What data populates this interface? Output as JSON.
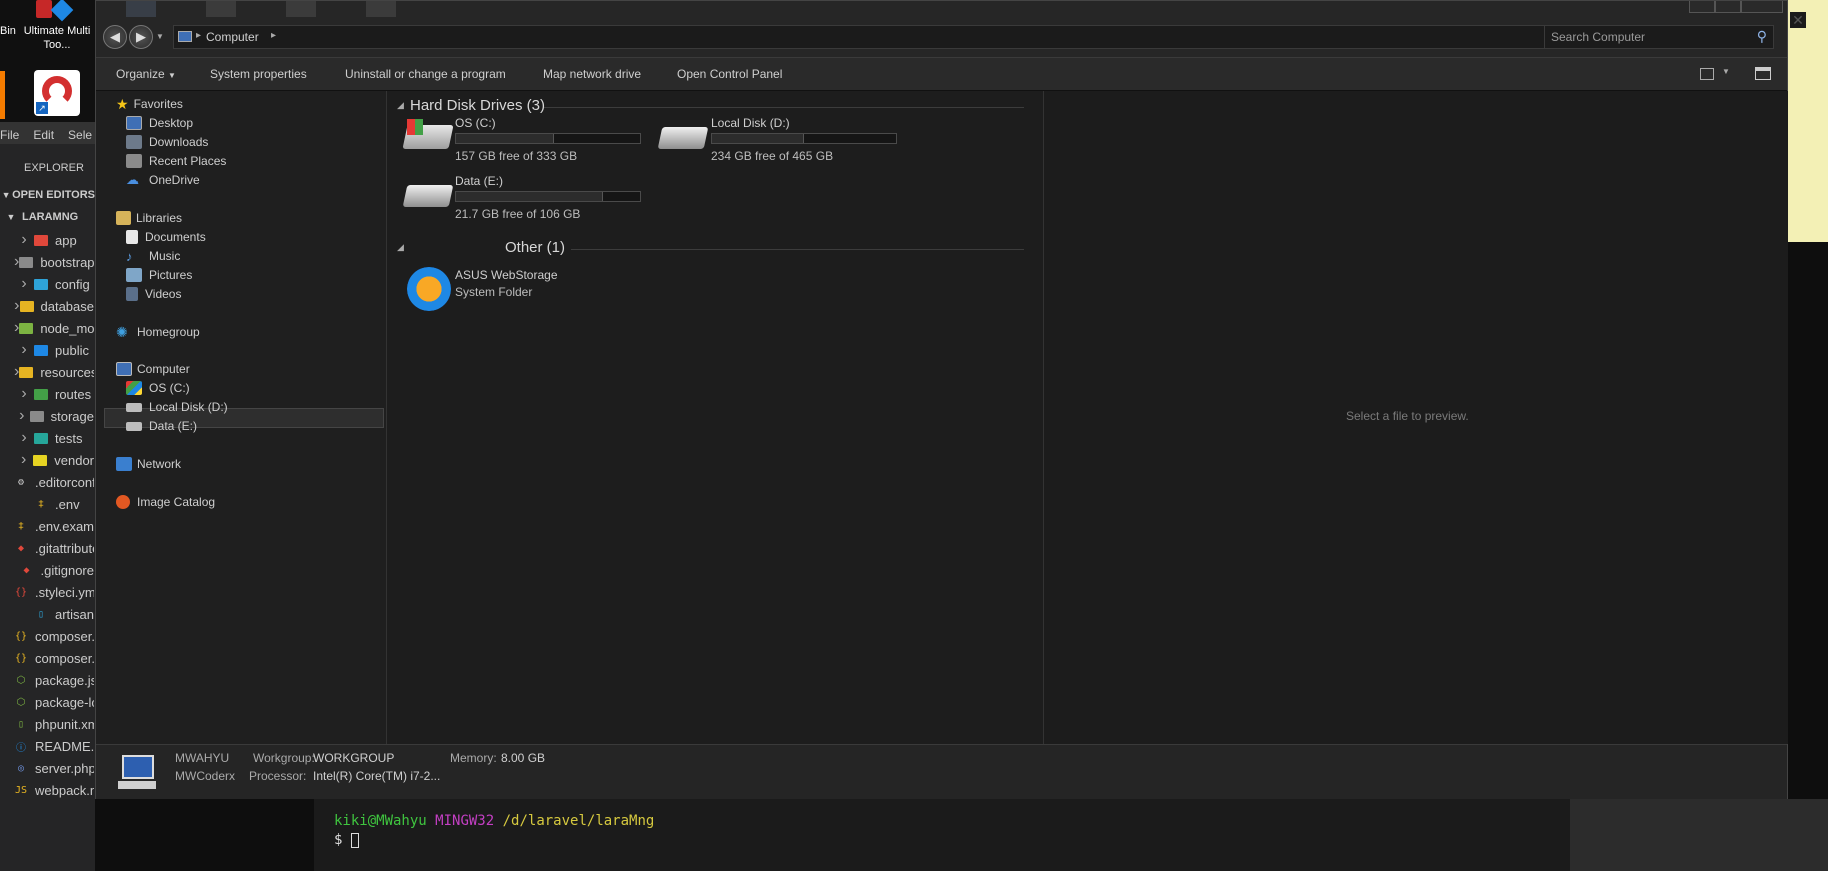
{
  "desktop": {
    "partial_label": "Bin",
    "ultimate_label": "Ultimate Multi Too..."
  },
  "vscode": {
    "menu": [
      "File",
      "Edit",
      "Sele"
    ],
    "explorer_title": "EXPLORER",
    "open_editors": "OPEN EDITORS",
    "project": "LARAMNG",
    "tree": [
      {
        "label": "app",
        "kind": "folder",
        "color": "#e0483b"
      },
      {
        "label": "bootstrap",
        "kind": "folder",
        "color": "#8a8a8a"
      },
      {
        "label": "config",
        "kind": "folder",
        "color": "#2ea3d8"
      },
      {
        "label": "database",
        "kind": "folder",
        "color": "#e6b422"
      },
      {
        "label": "node_modules",
        "kind": "folder",
        "color": "#7cb342"
      },
      {
        "label": "public",
        "kind": "folder",
        "color": "#1e88e5"
      },
      {
        "label": "resources",
        "kind": "folder",
        "color": "#e6b422"
      },
      {
        "label": "routes",
        "kind": "folder",
        "color": "#43a047"
      },
      {
        "label": "storage",
        "kind": "folder",
        "color": "#8a8a8a"
      },
      {
        "label": "tests",
        "kind": "folder",
        "color": "#26a69a"
      },
      {
        "label": "vendor",
        "kind": "folder",
        "color": "#e6d322"
      },
      {
        "label": ".editorconfig",
        "kind": "file",
        "glyph": "⚙",
        "color": "#cccccc"
      },
      {
        "label": ".env",
        "kind": "file",
        "glyph": "‡",
        "color": "#e6b422"
      },
      {
        "label": ".env.example",
        "kind": "file",
        "glyph": "‡",
        "color": "#e6b422"
      },
      {
        "label": ".gitattributes",
        "kind": "file",
        "glyph": "◆",
        "color": "#e0483b"
      },
      {
        "label": ".gitignore",
        "kind": "file",
        "glyph": "◆",
        "color": "#e0483b"
      },
      {
        "label": ".styleci.yml",
        "kind": "file",
        "glyph": "{}",
        "color": "#e0483b"
      },
      {
        "label": "artisan",
        "kind": "file",
        "glyph": "▯",
        "color": "#2ea3d8"
      },
      {
        "label": "composer.json",
        "kind": "file",
        "glyph": "{}",
        "color": "#e6b422"
      },
      {
        "label": "composer.lock",
        "kind": "file",
        "glyph": "{}",
        "color": "#e6b422"
      },
      {
        "label": "package.json",
        "kind": "file",
        "glyph": "⬡",
        "color": "#7cb342"
      },
      {
        "label": "package-lock.json",
        "kind": "file",
        "glyph": "⬡",
        "color": "#7cb342"
      },
      {
        "label": "phpunit.xml",
        "kind": "file",
        "glyph": "▯",
        "color": "#7cb342"
      },
      {
        "label": "README.md",
        "kind": "file",
        "glyph": "ⓘ",
        "color": "#2196f3"
      },
      {
        "label": "server.php",
        "kind": "file",
        "glyph": "◎",
        "color": "#6d8fd8"
      },
      {
        "label": "webpack.mix.js",
        "kind": "file",
        "glyph": "JS",
        "color": "#e6b422"
      }
    ]
  },
  "explorer": {
    "breadcrumb": "Computer",
    "search_placeholder": "Search Computer",
    "toolbar": {
      "organize": "Organize",
      "system_properties": "System properties",
      "uninstall": "Uninstall or change a program",
      "map_drive": "Map network drive",
      "control_panel": "Open Control Panel"
    },
    "nav": {
      "favorites": "Favorites",
      "favorites_items": [
        "Desktop",
        "Downloads",
        "Recent Places",
        "OneDrive"
      ],
      "libraries": "Libraries",
      "libraries_items": [
        "Documents",
        "Music",
        "Pictures",
        "Videos"
      ],
      "homegroup": "Homegroup",
      "computer": "Computer",
      "computer_items": [
        "OS (C:)",
        "Local Disk (D:)",
        "Data (E:)"
      ],
      "network": "Network",
      "image_catalog": "Image Catalog"
    },
    "groups": {
      "hdd_title": "Hard Disk Drives (3)",
      "other_title": "Other (1)"
    },
    "drives": [
      {
        "name": "OS (C:)",
        "free": "157 GB free of 333 GB",
        "used_fraction": 0.53
      },
      {
        "name": "Local Disk (D:)",
        "free": "234 GB free of 465 GB",
        "used_fraction": 0.5
      },
      {
        "name": "Data (E:)",
        "free": "21.7 GB free of 106 GB",
        "used_fraction": 0.8
      }
    ],
    "other": {
      "name": "ASUS WebStorage",
      "type": "System Folder"
    },
    "preview_text": "Select a file to preview.",
    "details": {
      "computer_name": "MWAHYU",
      "user": "MWCoderx",
      "workgroup_label": "Workgroup:",
      "workgroup_value": "WORKGROUP",
      "memory_label": "Memory:",
      "memory_value": "8.00 GB",
      "processor_label": "Processor:",
      "processor_value": "Intel(R) Core(TM) i7-2..."
    }
  },
  "terminal": {
    "user": "kiki@MWahyu",
    "env": "MINGW32",
    "path": "/d/laravel/laraMng",
    "prompt": "$"
  }
}
